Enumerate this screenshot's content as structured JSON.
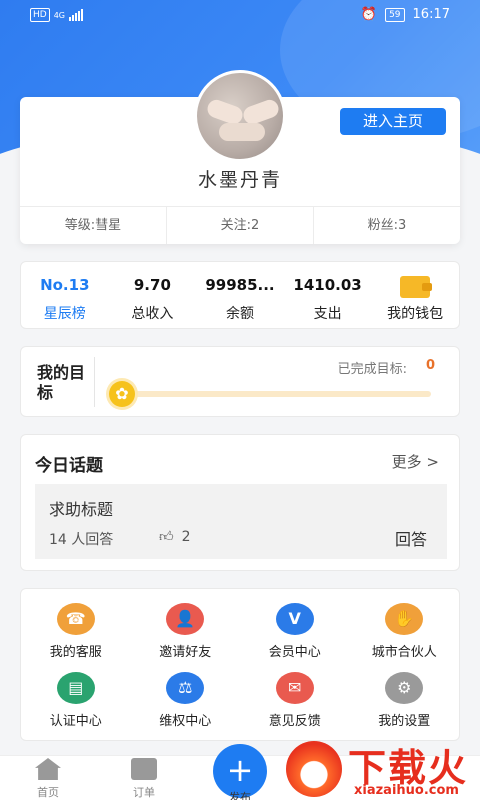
{
  "status": {
    "network": "4G",
    "hd": "HD",
    "battery": "59",
    "time": "16:17"
  },
  "profile": {
    "enter_home_label": "进入主页",
    "username": "水墨丹青",
    "level": "等级:彗星",
    "following": "关注:2",
    "followers": "粉丝:3"
  },
  "wallet": {
    "rank_value": "No.13",
    "rank_label": "星辰榜",
    "income_value": "9.70",
    "income_label": "总收入",
    "balance_value": "99985...",
    "balance_label": "余额",
    "expense_value": "1410.03",
    "expense_label": "支出",
    "wallet_label": "我的钱包"
  },
  "goal": {
    "title": "我的目标",
    "done_label": "已完成目标:",
    "done_count": "0",
    "progress": 0
  },
  "topic": {
    "header": "今日话题",
    "more": "更多 >",
    "question": "求助标题",
    "answer_count": "14  人回答",
    "likes": "2",
    "answer_button": "回答"
  },
  "services": [
    {
      "label": "我的客服",
      "icon": "headset-icon",
      "color": "#f0a03a",
      "glyph": "☎"
    },
    {
      "label": "邀请好友",
      "icon": "invite-user-icon",
      "color": "#e95a4f",
      "glyph": "👤"
    },
    {
      "label": "会员中心",
      "icon": "vip-icon",
      "color": "#2b7be8",
      "glyph": "V"
    },
    {
      "label": "城市合伙人",
      "icon": "handshake-icon",
      "color": "#f0a03a",
      "glyph": "✋"
    },
    {
      "label": "认证中心",
      "icon": "id-card-icon",
      "color": "#2aa36f",
      "glyph": "▤"
    },
    {
      "label": "维权中心",
      "icon": "gavel-icon",
      "color": "#2b7be8",
      "glyph": "⚖"
    },
    {
      "label": "意见反馈",
      "icon": "feedback-mail-icon",
      "color": "#e95a4f",
      "glyph": "✉"
    },
    {
      "label": "我的设置",
      "icon": "gear-icon",
      "color": "#9a9a9a",
      "glyph": "⚙"
    }
  ],
  "nav": {
    "home": "首页",
    "orders": "订单",
    "publish": "发布",
    "publish_glyph": "+"
  },
  "watermark": {
    "text": "下载火",
    "url": "xiazaihuo.com"
  }
}
